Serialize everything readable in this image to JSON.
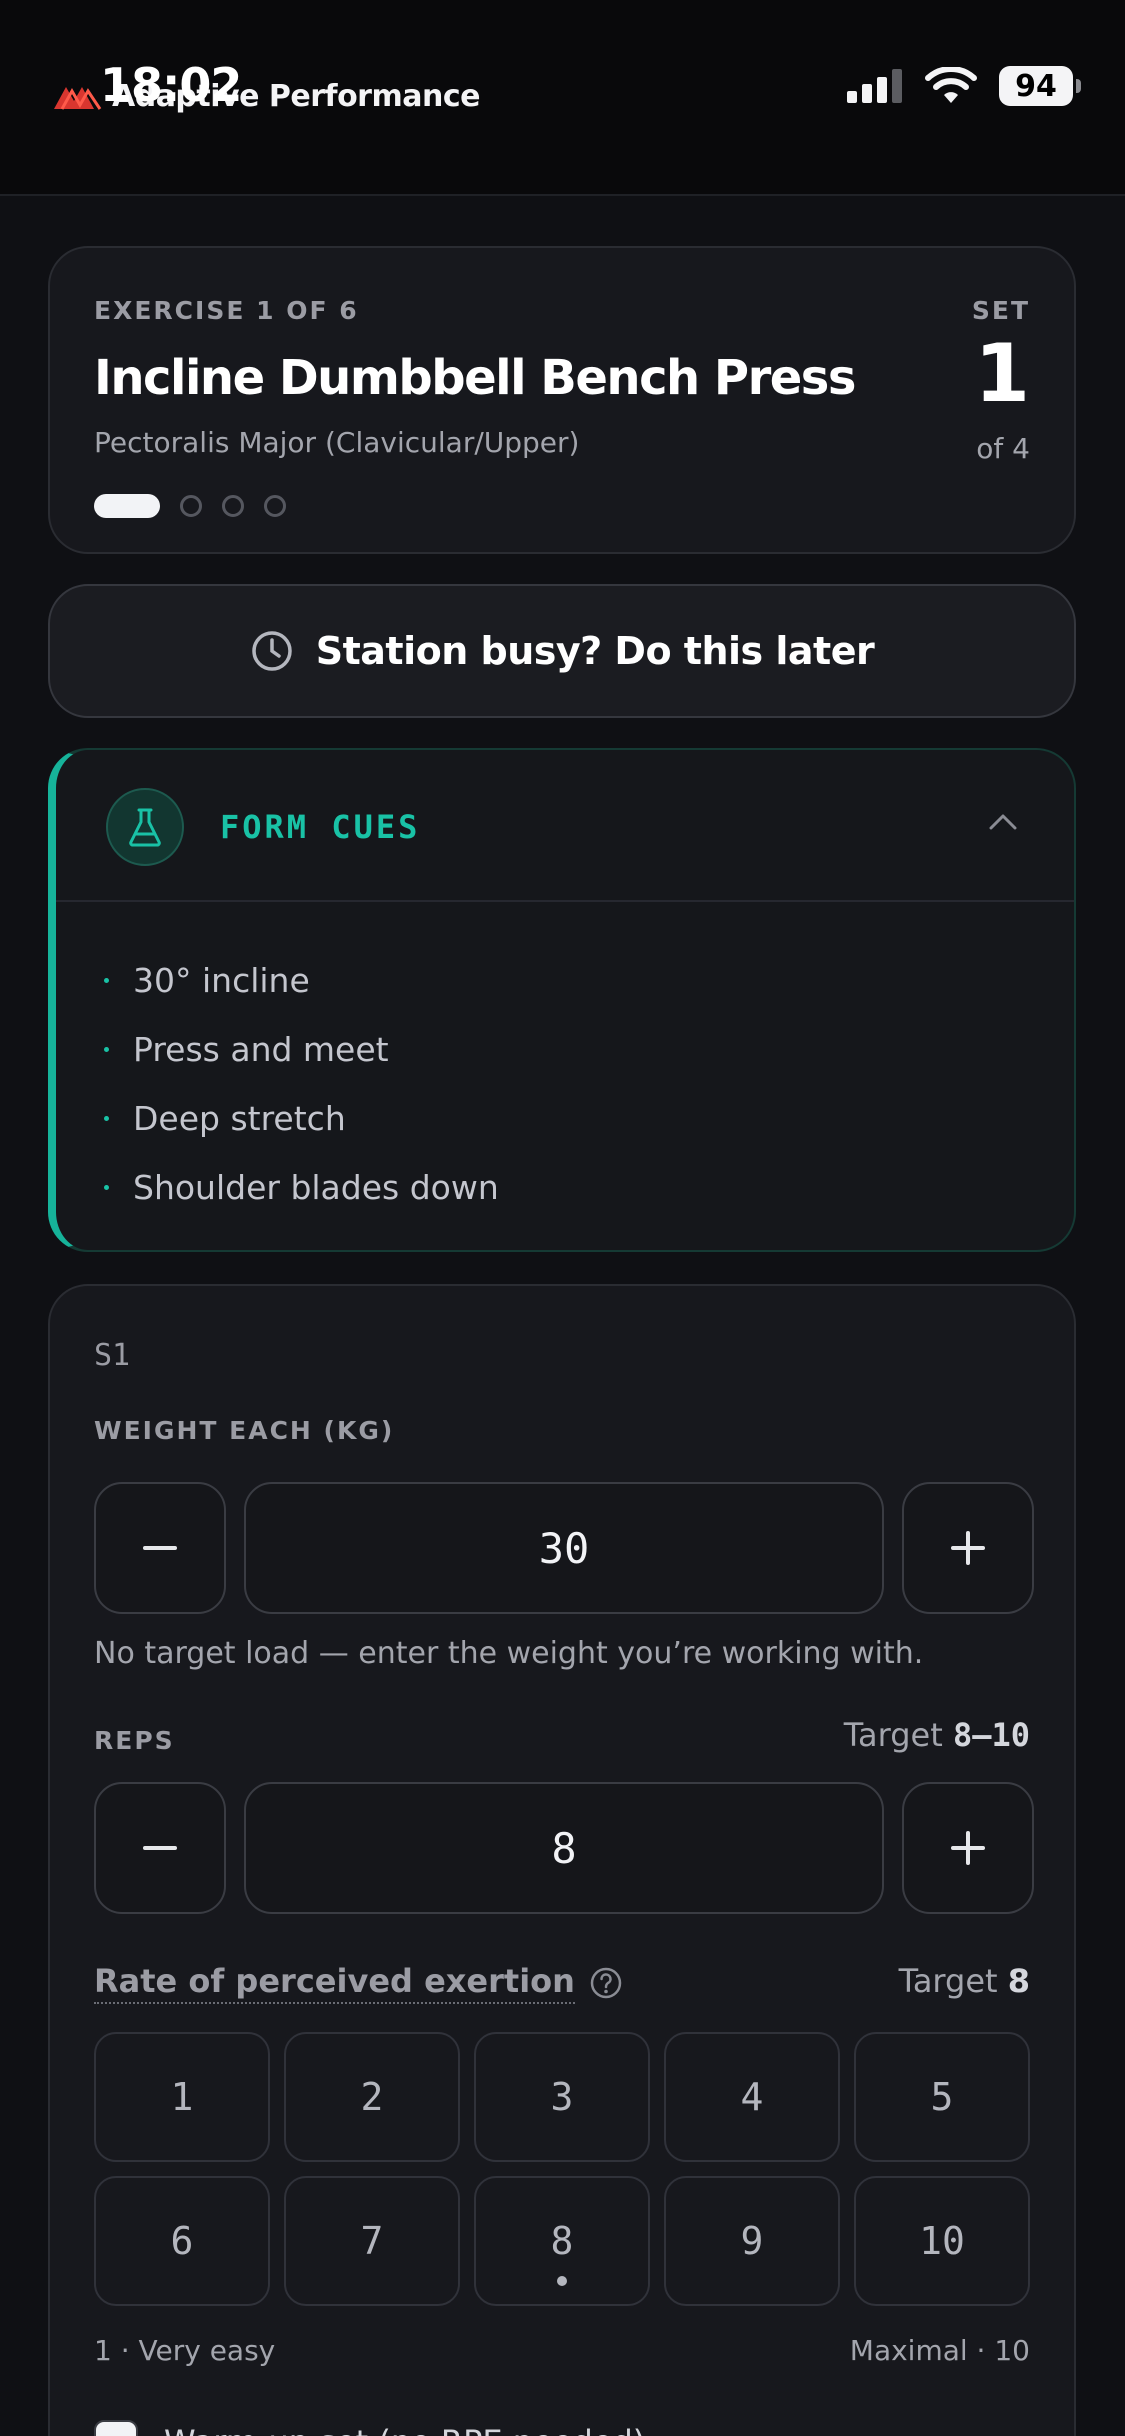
{
  "status_bar": {
    "time": "18:02",
    "battery": "94"
  },
  "header": {
    "brand": "Adaptive Performance"
  },
  "exercise": {
    "eyebrow": "EXERCISE 1 OF 6",
    "title": "Incline Dumbbell Bench Press",
    "muscle": "Pectoralis Major (Clavicular/Upper)",
    "set_label": "SET",
    "set_number": "1",
    "set_of": "of 4"
  },
  "later_button": {
    "label": "Station busy? Do this later"
  },
  "form_cues": {
    "title": "FORM CUES",
    "items": [
      "30° incline",
      "Press and meet",
      "Deep stretch",
      "Shoulder blades down"
    ]
  },
  "set_entry": {
    "set_tag": "S1",
    "weight_label": "WEIGHT EACH (KG)",
    "weight_value": "30",
    "minus_symbol": "−",
    "plus_symbol": "+",
    "weight_hint": "No target load — enter the weight you’re working with.",
    "reps_label": "REPS",
    "reps_target_prefix": "Target ",
    "reps_target_value": "8–10",
    "reps_value": "8",
    "rpe_label": "Rate of perceived exertion",
    "rpe_target_prefix": "Target ",
    "rpe_target_value": "8",
    "rpe_options": [
      "1",
      "2",
      "3",
      "4",
      "5",
      "6",
      "7",
      "8",
      "9",
      "10"
    ],
    "rpe_marked": "8",
    "scale_low": "1 · Very easy",
    "scale_high": "Maximal · 10",
    "warmup_label": "Warm-up set (no RPE needed)"
  },
  "colors": {
    "accent": "#19c2a6",
    "background": "#0f1014",
    "card": "#17181d"
  }
}
